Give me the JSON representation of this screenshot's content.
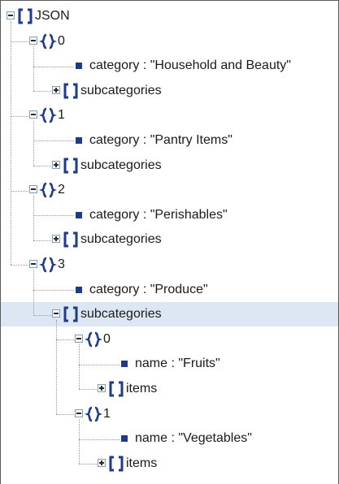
{
  "icons": {
    "array": "bracket-array-icon",
    "object": "brace-object-icon",
    "leaf": "square-leaf-icon",
    "expanded": "minus-box-icon",
    "collapsed": "plus-box-icon"
  },
  "colors": {
    "icon_blue": "#1e3a8a",
    "selected_row": "#dde7f4",
    "guide_line": "#9a9a9a",
    "toggle_border": "#7f9db9"
  },
  "tree": [
    {
      "label": "JSON",
      "type": "array",
      "depth": 0,
      "state": "expanded"
    },
    {
      "label": "0",
      "type": "object",
      "depth": 1,
      "state": "expanded"
    },
    {
      "label": "category : \"Household and Beauty\"",
      "type": "leaf",
      "depth": 2
    },
    {
      "label": "subcategories",
      "type": "array",
      "depth": 2,
      "state": "collapsed"
    },
    {
      "label": "1",
      "type": "object",
      "depth": 1,
      "state": "expanded"
    },
    {
      "label": "category : \"Pantry Items\"",
      "type": "leaf",
      "depth": 2
    },
    {
      "label": "subcategories",
      "type": "array",
      "depth": 2,
      "state": "collapsed"
    },
    {
      "label": "2",
      "type": "object",
      "depth": 1,
      "state": "expanded"
    },
    {
      "label": "category : \"Perishables\"",
      "type": "leaf",
      "depth": 2
    },
    {
      "label": "subcategories",
      "type": "array",
      "depth": 2,
      "state": "collapsed"
    },
    {
      "label": "3",
      "type": "object",
      "depth": 1,
      "state": "expanded"
    },
    {
      "label": "category : \"Produce\"",
      "type": "leaf",
      "depth": 2
    },
    {
      "label": "subcategories",
      "type": "array",
      "depth": 2,
      "state": "expanded",
      "selected": true
    },
    {
      "label": "0",
      "type": "object",
      "depth": 3,
      "state": "expanded"
    },
    {
      "label": "name : \"Fruits\"",
      "type": "leaf",
      "depth": 4
    },
    {
      "label": "items",
      "type": "array",
      "depth": 4,
      "state": "collapsed"
    },
    {
      "label": "1",
      "type": "object",
      "depth": 3,
      "state": "expanded"
    },
    {
      "label": "name : \"Vegetables\"",
      "type": "leaf",
      "depth": 4
    },
    {
      "label": "items",
      "type": "array",
      "depth": 4,
      "state": "collapsed"
    }
  ]
}
